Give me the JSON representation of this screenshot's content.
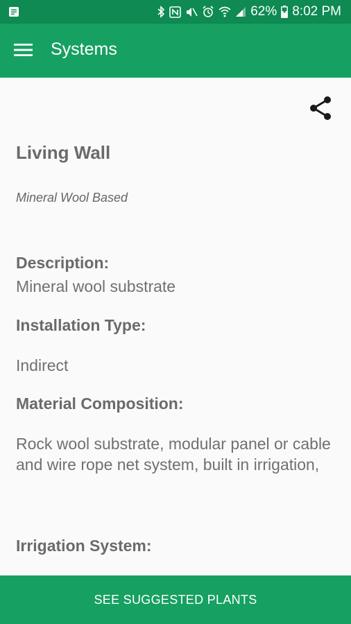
{
  "status_bar": {
    "battery": "62%",
    "time": "8:02 PM",
    "icons": [
      "notification-icon",
      "bluetooth-icon",
      "nfc-icon",
      "mute-icon",
      "alarm-icon",
      "wifi-icon",
      "signal-icon",
      "battery-charging-icon"
    ]
  },
  "appbar": {
    "title": "Systems",
    "menu_icon": "hamburger-menu-icon"
  },
  "detail": {
    "share_icon": "share-icon",
    "title": "Living Wall",
    "subtitle": "Mineral Wool Based",
    "description_label": "Description:",
    "description_value": "Mineral wool substrate",
    "installation_label": "Installation Type:",
    "installation_value": "Indirect",
    "material_label": "Material Composition:",
    "material_value": "Rock wool substrate,  modular panel or cable and wire rope net system,  built in irrigation,",
    "irrigation_label": "Irrigation System:"
  },
  "bottom_button": {
    "label": "SEE SUGGESTED PLANTS"
  },
  "colors": {
    "status_bar": "#0e8a52",
    "app_bar": "#16a062",
    "text_dark": "#6a6a6a",
    "background": "#fafafa"
  }
}
